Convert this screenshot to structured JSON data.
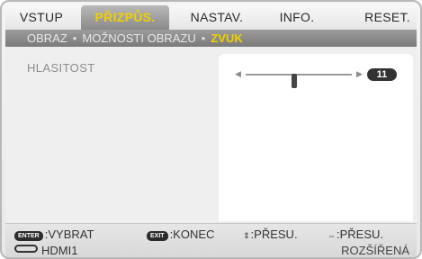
{
  "tabs": [
    {
      "label": "VSTUP"
    },
    {
      "label": "PŘIZPŮS."
    },
    {
      "label": "NASTAV."
    },
    {
      "label": "INFO."
    },
    {
      "label": "RESET."
    }
  ],
  "breadcrumb": {
    "items": [
      "OBRAZ",
      "MOŽNOSTI OBRAZU",
      "ZVUK"
    ],
    "separator": "•"
  },
  "setting": {
    "label": "HLASITOST",
    "value": "11",
    "level_fraction": 0.46
  },
  "footer": {
    "enter_key": "ENTER",
    "enter_text": ":VYBRAT",
    "exit_key": "EXIT",
    "exit_text": ":KONEC",
    "updown_icon": "⇕",
    "updown_text": ":PŘESU.",
    "leftright_icon": "⇔",
    "leftright_text": ":PŘESU.",
    "source": "HDMI1",
    "mode": "ROZŠÍŘENÁ"
  },
  "colors": {
    "active_tab_text": "#f2d000",
    "current_crumb": "#f2d000"
  }
}
